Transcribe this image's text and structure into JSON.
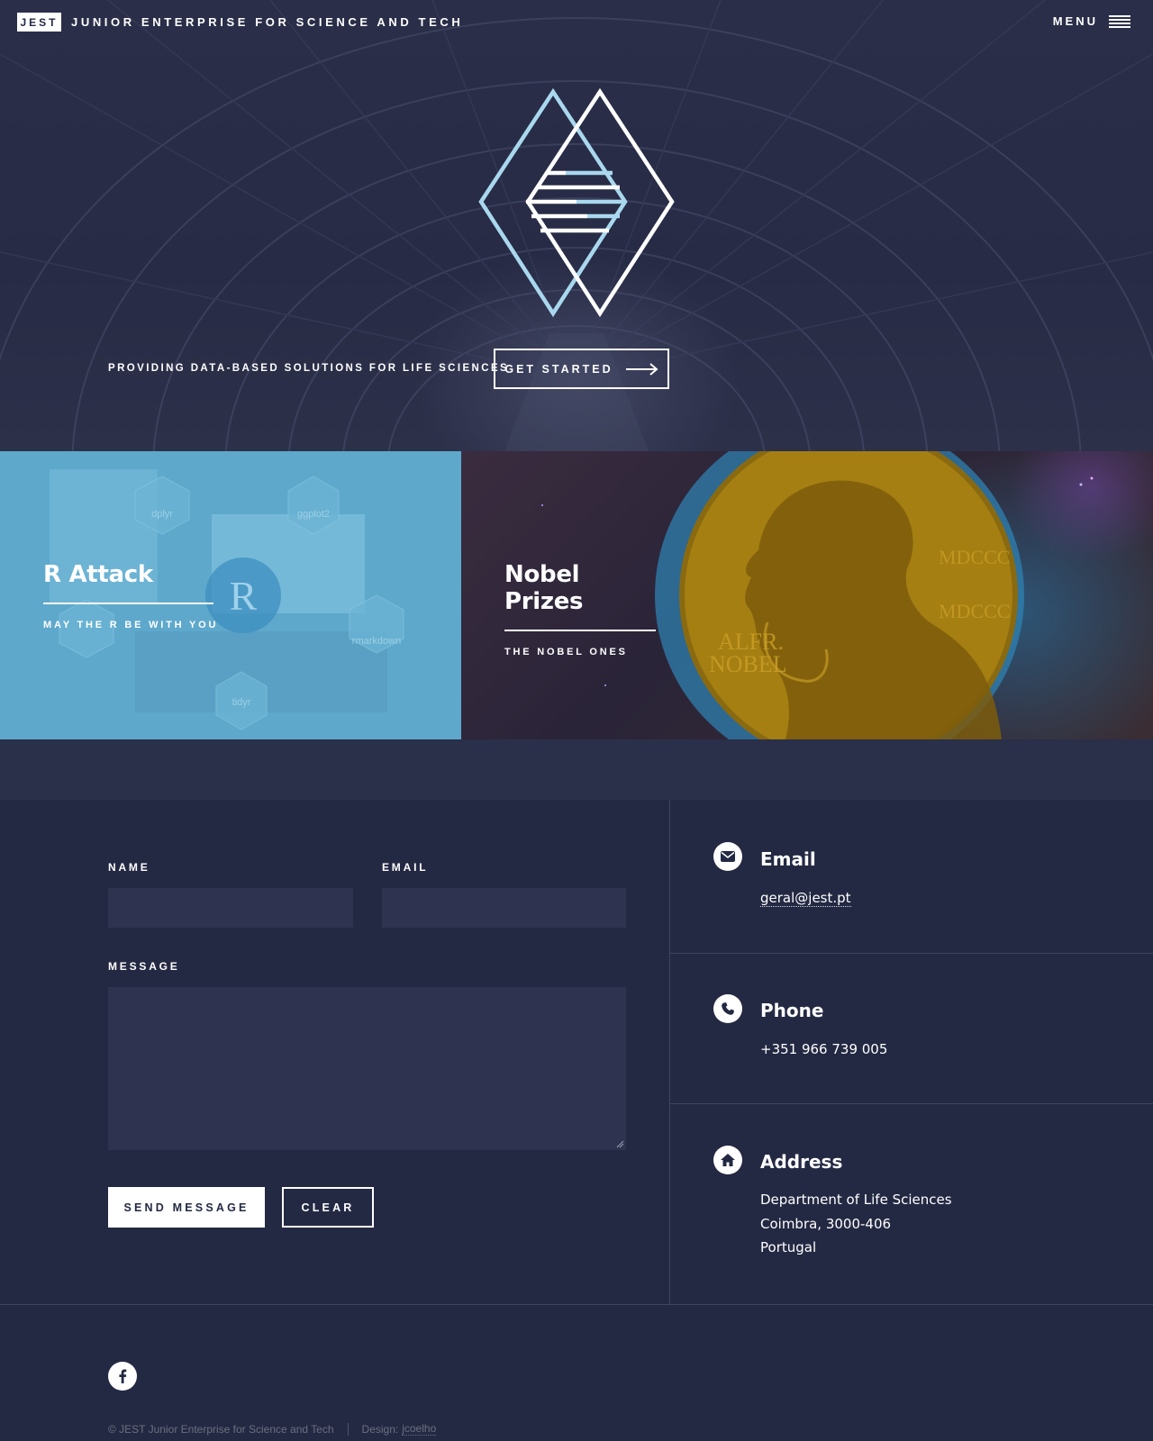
{
  "header": {
    "logo": "JEST",
    "site_name": "JUNIOR ENTERPRISE FOR SCIENCE AND TECH",
    "menu_label": "MENU"
  },
  "hero": {
    "tagline": "PROVIDING DATA-BASED SOLUTIONS FOR LIFE SCIENCES",
    "cta_label": "GET STARTED"
  },
  "tiles": [
    {
      "title": "R Attack",
      "subtitle": "MAY THE R BE WITH YOU",
      "hex_labels": [
        "dplyr",
        "ggplot2",
        "R",
        "rmarkdown",
        "tidyr"
      ]
    },
    {
      "title": "Nobel Prizes",
      "subtitle": "THE NOBEL ONES"
    }
  ],
  "form": {
    "name_label": "NAME",
    "email_label": "EMAIL",
    "message_label": "MESSAGE",
    "name_value": "",
    "email_value": "",
    "message_value": "",
    "send_label": "SEND MESSAGE",
    "clear_label": "CLEAR"
  },
  "contact_info": {
    "email": {
      "title": "Email",
      "value": "geral@jest.pt"
    },
    "phone": {
      "title": "Phone",
      "value": "+351 966 739 005"
    },
    "address": {
      "title": "Address",
      "line1": "Department of Life Sciences",
      "line2": "Coimbra, 3000-406",
      "line3": "Portugal"
    }
  },
  "footer": {
    "copyright": "© JEST Junior Enterprise for Science and Tech",
    "design_prefix": "Design:",
    "design_link": "jcoelho"
  },
  "colors": {
    "background": "#242943",
    "field": "#2e334f",
    "logo_light_blue": "#a9d8ee",
    "r_tile": "#5ea8cc"
  }
}
